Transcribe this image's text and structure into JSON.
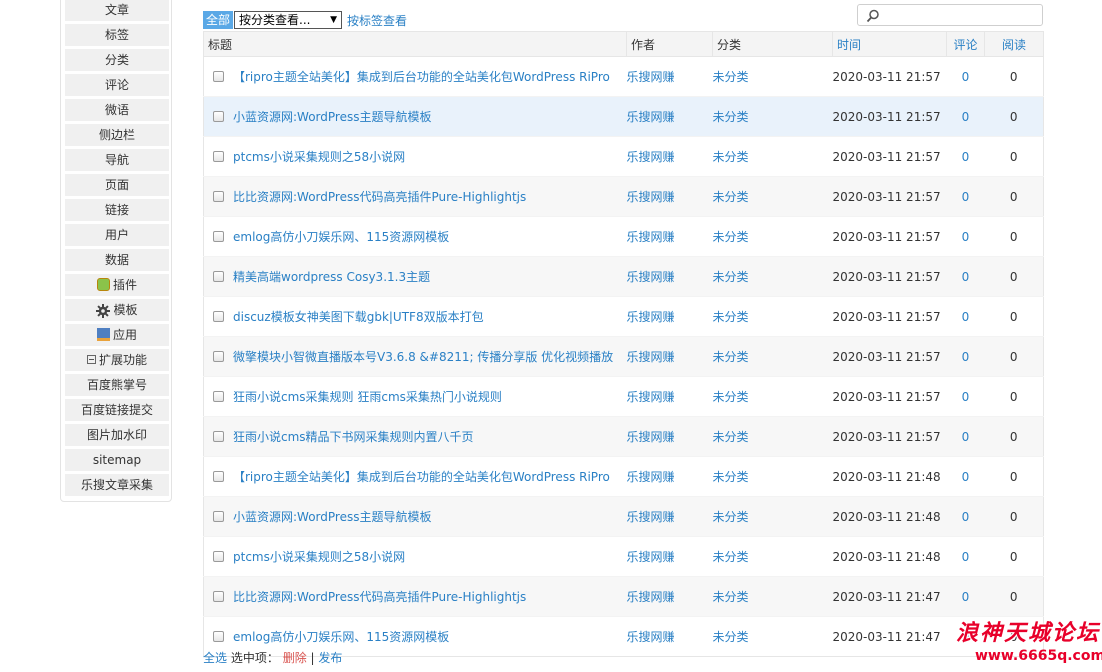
{
  "sidebar": {
    "items": [
      {
        "label": "文章",
        "icon": ""
      },
      {
        "label": "标签",
        "icon": ""
      },
      {
        "label": "分类",
        "icon": ""
      },
      {
        "label": "评论",
        "icon": ""
      },
      {
        "label": "微语",
        "icon": ""
      },
      {
        "label": "侧边栏",
        "icon": ""
      },
      {
        "label": "导航",
        "icon": ""
      },
      {
        "label": "页面",
        "icon": ""
      },
      {
        "label": "链接",
        "icon": ""
      },
      {
        "label": "用户",
        "icon": ""
      },
      {
        "label": "数据",
        "icon": ""
      },
      {
        "label": "插件",
        "icon": "plugin-icon"
      },
      {
        "label": "模板",
        "icon": "gear-icon"
      },
      {
        "label": "应用",
        "icon": "app-icon"
      },
      {
        "label": "扩展功能",
        "icon": "collapse-icon"
      },
      {
        "label": "百度熊掌号",
        "icon": ""
      },
      {
        "label": "百度链接提交",
        "icon": ""
      },
      {
        "label": "图片加水印",
        "icon": ""
      },
      {
        "label": "sitemap",
        "icon": ""
      },
      {
        "label": "乐搜文章采集",
        "icon": ""
      }
    ]
  },
  "toolbar": {
    "all_label": "全部",
    "category_select": "按分类查看...",
    "tag_link": "按标签查看",
    "search_placeholder": ""
  },
  "table": {
    "headers": {
      "title": "标题",
      "author": "作者",
      "category": "分类",
      "time": "时间",
      "comments": "评论",
      "views": "阅读"
    },
    "rows": [
      {
        "title": "【ripro主题全站美化】集成到后台功能的全站美化包WordPress RiPro",
        "author": "乐搜网赚",
        "category": "未分类",
        "time": "2020-03-11 21:57",
        "comments": "0",
        "views": "0"
      },
      {
        "title": "小蓝资源网:WordPress主题导航模板",
        "author": "乐搜网赚",
        "category": "未分类",
        "time": "2020-03-11 21:57",
        "comments": "0",
        "views": "0"
      },
      {
        "title": "ptcms小说采集规则之58小说网",
        "author": "乐搜网赚",
        "category": "未分类",
        "time": "2020-03-11 21:57",
        "comments": "0",
        "views": "0"
      },
      {
        "title": "比比资源网:WordPress代码高亮插件Pure-Highlightjs",
        "author": "乐搜网赚",
        "category": "未分类",
        "time": "2020-03-11 21:57",
        "comments": "0",
        "views": "0"
      },
      {
        "title": "emlog高仿小刀娱乐网、115资源网模板",
        "author": "乐搜网赚",
        "category": "未分类",
        "time": "2020-03-11 21:57",
        "comments": "0",
        "views": "0"
      },
      {
        "title": "精美高端wordpress Cosy3.1.3主题",
        "author": "乐搜网赚",
        "category": "未分类",
        "time": "2020-03-11 21:57",
        "comments": "0",
        "views": "0"
      },
      {
        "title": "discuz模板女神美图下载gbk|UTF8双版本打包",
        "author": "乐搜网赚",
        "category": "未分类",
        "time": "2020-03-11 21:57",
        "comments": "0",
        "views": "0"
      },
      {
        "title": "微擎模块小智微直播版本号V3.6.8 &#8211; 传播分享版 优化视频播放",
        "author": "乐搜网赚",
        "category": "未分类",
        "time": "2020-03-11 21:57",
        "comments": "0",
        "views": "0"
      },
      {
        "title": "狂雨小说cms采集规则 狂雨cms采集热门小说规则",
        "author": "乐搜网赚",
        "category": "未分类",
        "time": "2020-03-11 21:57",
        "comments": "0",
        "views": "0"
      },
      {
        "title": "狂雨小说cms精品下书网采集规则内置八千页",
        "author": "乐搜网赚",
        "category": "未分类",
        "time": "2020-03-11 21:57",
        "comments": "0",
        "views": "0"
      },
      {
        "title": "【ripro主题全站美化】集成到后台功能的全站美化包WordPress RiPro",
        "author": "乐搜网赚",
        "category": "未分类",
        "time": "2020-03-11 21:48",
        "comments": "0",
        "views": "0"
      },
      {
        "title": "小蓝资源网:WordPress主题导航模板",
        "author": "乐搜网赚",
        "category": "未分类",
        "time": "2020-03-11 21:48",
        "comments": "0",
        "views": "0"
      },
      {
        "title": "ptcms小说采集规则之58小说网",
        "author": "乐搜网赚",
        "category": "未分类",
        "time": "2020-03-11 21:48",
        "comments": "0",
        "views": "0"
      },
      {
        "title": "比比资源网:WordPress代码高亮插件Pure-Highlightjs",
        "author": "乐搜网赚",
        "category": "未分类",
        "time": "2020-03-11 21:47",
        "comments": "0",
        "views": "0"
      },
      {
        "title": "emlog高仿小刀娱乐网、115资源网模板",
        "author": "乐搜网赚",
        "category": "未分类",
        "time": "2020-03-11 21:47",
        "comments": "0",
        "views": "0"
      }
    ]
  },
  "footer": {
    "select_all": "全选",
    "selected_label": "选中项：",
    "delete": "删除",
    "sep": "|",
    "publish": "发布"
  },
  "watermark": {
    "line1": "浪神天城论坛",
    "line2": "www.6665q.com"
  },
  "colors": {
    "link": "#2a80c5",
    "accent": "#5aa8e6",
    "danger": "#d9534f",
    "watermark": "#e8002a"
  }
}
